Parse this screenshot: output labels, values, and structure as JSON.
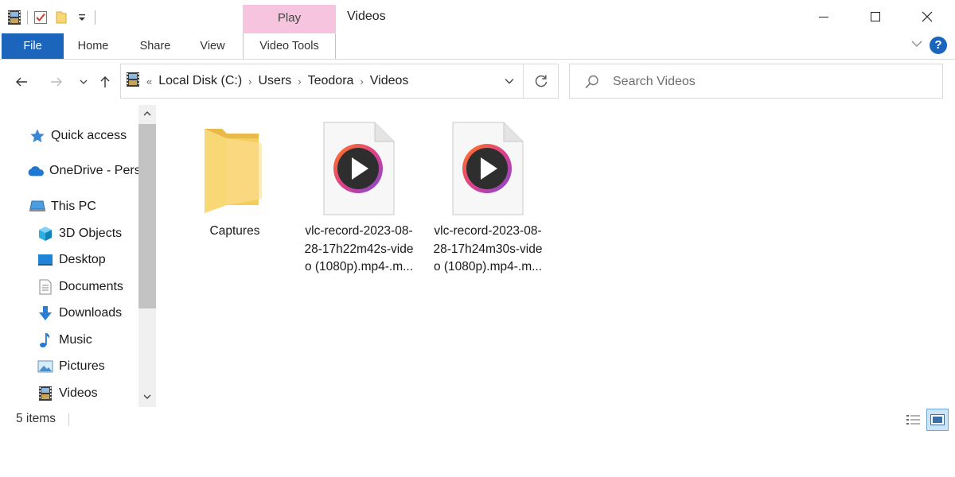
{
  "window": {
    "title": "Videos",
    "contextual_tab": "Play"
  },
  "ribbon": {
    "tabs": [
      {
        "label": "File"
      },
      {
        "label": "Home"
      },
      {
        "label": "Share"
      },
      {
        "label": "View"
      },
      {
        "label": "Video Tools"
      }
    ]
  },
  "address": {
    "overflow": "«",
    "crumbs": [
      "Local Disk (C:)",
      "Users",
      "Teodora",
      "Videos"
    ]
  },
  "search": {
    "placeholder": "Search Videos"
  },
  "navpane": {
    "items": [
      {
        "label": "Quick access",
        "icon": "star-icon"
      },
      {
        "label": "OneDrive - Pers",
        "icon": "onedrive-cloud-icon"
      },
      {
        "label": "This PC",
        "icon": "computer-icon"
      },
      {
        "label": "3D Objects",
        "icon": "cube-icon"
      },
      {
        "label": "Desktop",
        "icon": "desktop-icon"
      },
      {
        "label": "Documents",
        "icon": "document-icon"
      },
      {
        "label": "Downloads",
        "icon": "download-arrow-icon"
      },
      {
        "label": "Music",
        "icon": "music-note-icon"
      },
      {
        "label": "Pictures",
        "icon": "picture-icon"
      },
      {
        "label": "Videos",
        "icon": "film-icon"
      }
    ]
  },
  "files": [
    {
      "name": "Captures",
      "type": "folder"
    },
    {
      "name": "vlc-record-2023-08-28-17h22m42s-video (1080p).mp4-.m...",
      "type": "video"
    },
    {
      "name": "vlc-record-2023-08-28-17h24m30s-video (1080p).mp4-.m...",
      "type": "video"
    }
  ],
  "status": {
    "item_count": "5 items"
  },
  "colors": {
    "file_tab": "#1b65bd",
    "contextual_header": "#f7c4e0",
    "folder": "#f8d775",
    "play_ring": "#e05a2a"
  }
}
